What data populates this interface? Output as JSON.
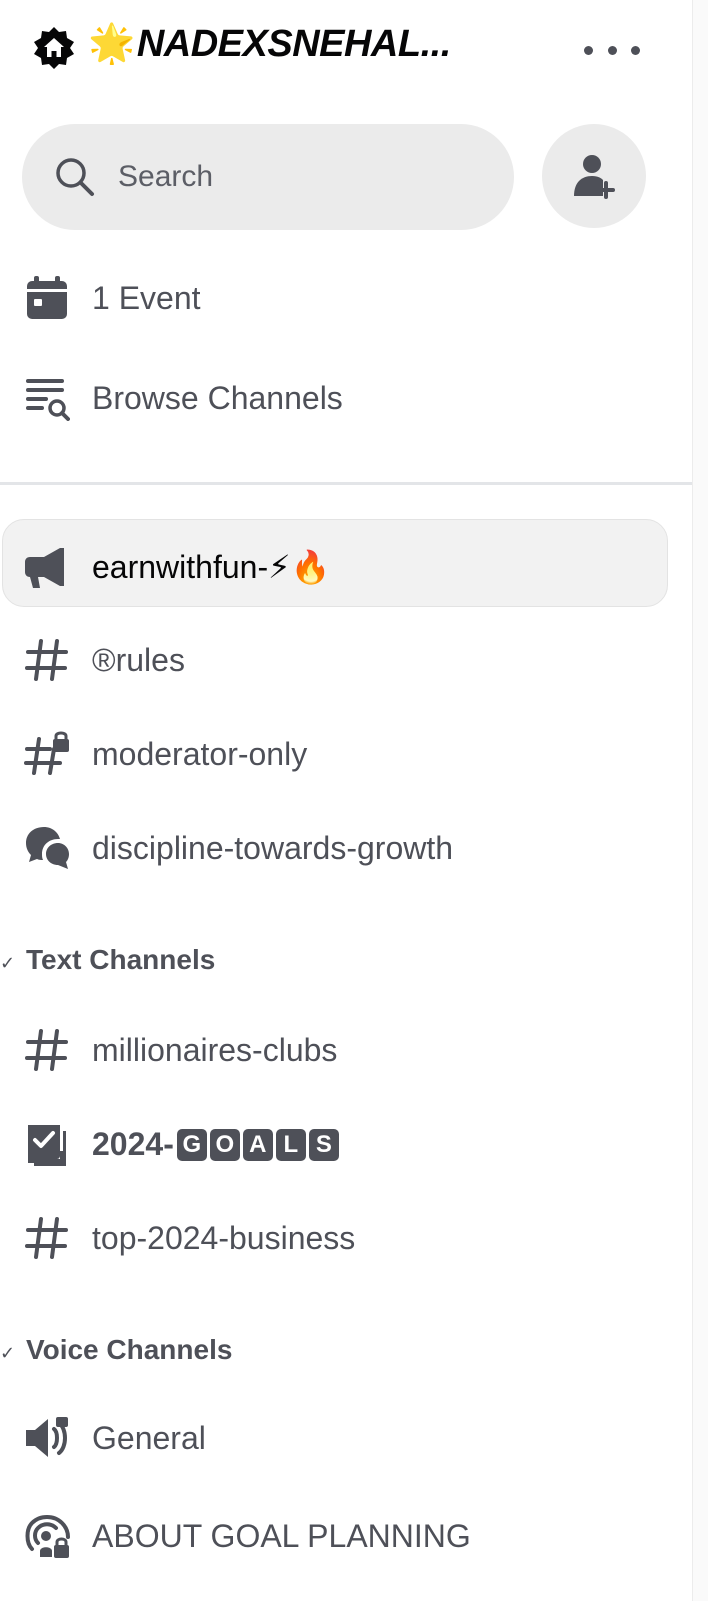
{
  "header": {
    "server_emoji": "🌟",
    "server_name": "NADEXSNEHAL..."
  },
  "search": {
    "placeholder": "Search"
  },
  "top_items": [
    {
      "label": "1 Event",
      "icon": "calendar-icon"
    },
    {
      "label": "Browse Channels",
      "icon": "browse-channels-icon"
    }
  ],
  "channels": [
    {
      "label": "earnwithfun-",
      "emoji": "⚡🔥",
      "icon": "announcement-icon",
      "active": true
    },
    {
      "label": "®rules",
      "icon": "hashtag-icon"
    },
    {
      "label": "moderator-only",
      "icon": "locked-hashtag-icon"
    },
    {
      "label": "discipline-towards-growth",
      "icon": "forum-icon"
    }
  ],
  "text_category": {
    "label": "Text Channels"
  },
  "text_channels": [
    {
      "label": "millionaires-clubs",
      "icon": "hashtag-icon"
    },
    {
      "label": "2024-",
      "letters": [
        "G",
        "O",
        "A",
        "L",
        "S"
      ],
      "icon": "checklist-icon"
    },
    {
      "label": "top-2024-business",
      "icon": "hashtag-icon"
    }
  ],
  "voice_category": {
    "label": "Voice Channels"
  },
  "voice_channels": [
    {
      "label": "General",
      "icon": "voice-channel-icon"
    },
    {
      "label": "ABOUT GOAL PLANNING",
      "icon": "stage-channel-icon"
    }
  ]
}
